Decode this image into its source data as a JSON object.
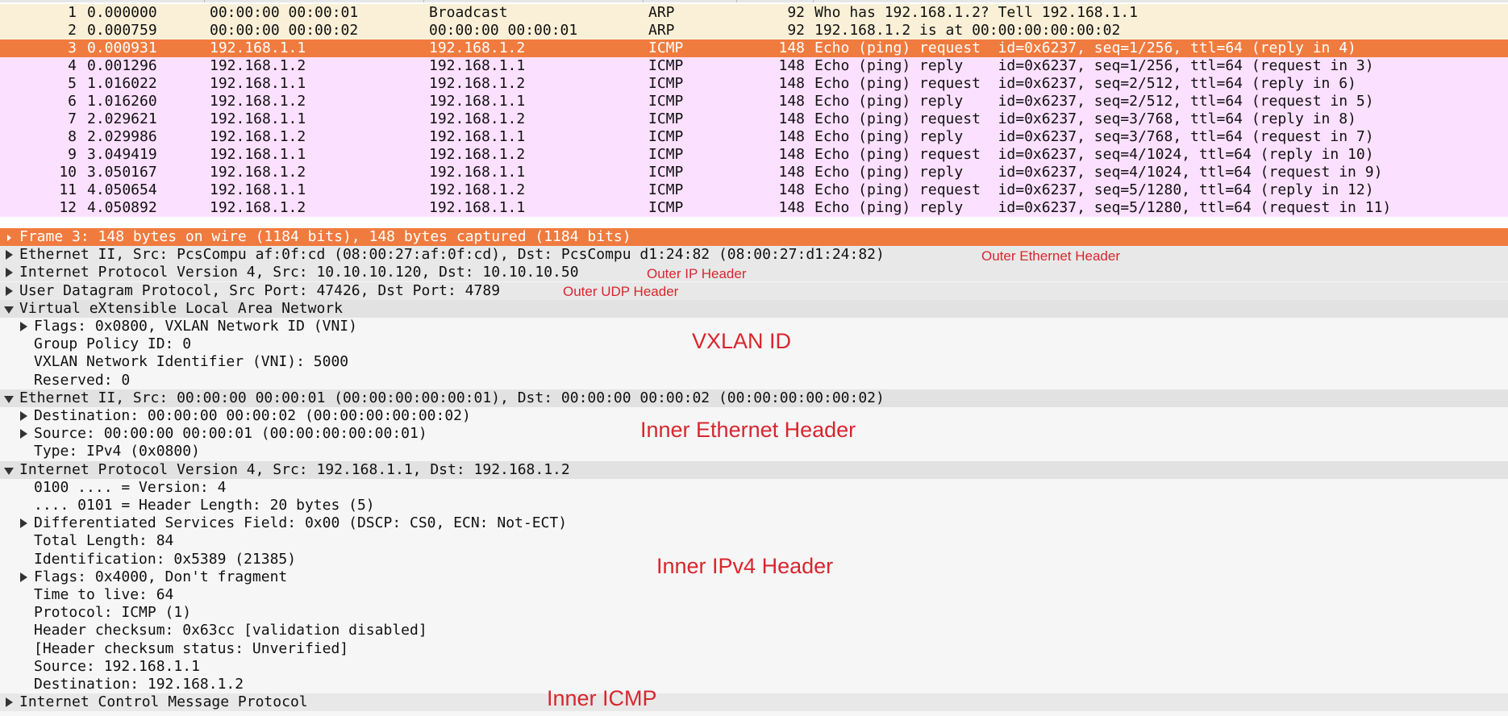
{
  "colors": {
    "arp_row_bg": "#faf0d7",
    "icmp_row_bg": "#fce0ff",
    "selected_row_bg": "#f07b3f",
    "selected_row_text": "#ffffff",
    "tree_header_bg": "#e2e2e2",
    "detail_bg": "#f6f6f6",
    "annotation": "#d8262e"
  },
  "packet_list": {
    "selected_no": "3",
    "rows": [
      {
        "no": "1",
        "time": "0.000000",
        "src": "00:00:00 00:00:01",
        "dst": "Broadcast",
        "proto": "ARP",
        "len": "92",
        "info": "Who has 192.168.1.2? Tell 192.168.1.1",
        "kind": "arp"
      },
      {
        "no": "2",
        "time": "0.000759",
        "src": "00:00:00 00:00:02",
        "dst": "00:00:00 00:00:01",
        "proto": "ARP",
        "len": "92",
        "info": "192.168.1.2 is at 00:00:00:00:00:02",
        "kind": "arp"
      },
      {
        "no": "3",
        "time": "0.000931",
        "src": "192.168.1.1",
        "dst": "192.168.1.2",
        "proto": "ICMP",
        "len": "148",
        "info": "Echo (ping) request  id=0x6237, seq=1/256, ttl=64 (reply in 4)",
        "kind": "selected"
      },
      {
        "no": "4",
        "time": "0.001296",
        "src": "192.168.1.2",
        "dst": "192.168.1.1",
        "proto": "ICMP",
        "len": "148",
        "info": "Echo (ping) reply    id=0x6237, seq=1/256, ttl=64 (request in 3)",
        "kind": "icmp"
      },
      {
        "no": "5",
        "time": "1.016022",
        "src": "192.168.1.1",
        "dst": "192.168.1.2",
        "proto": "ICMP",
        "len": "148",
        "info": "Echo (ping) request  id=0x6237, seq=2/512, ttl=64 (reply in 6)",
        "kind": "icmp"
      },
      {
        "no": "6",
        "time": "1.016260",
        "src": "192.168.1.2",
        "dst": "192.168.1.1",
        "proto": "ICMP",
        "len": "148",
        "info": "Echo (ping) reply    id=0x6237, seq=2/512, ttl=64 (request in 5)",
        "kind": "icmp"
      },
      {
        "no": "7",
        "time": "2.029621",
        "src": "192.168.1.1",
        "dst": "192.168.1.2",
        "proto": "ICMP",
        "len": "148",
        "info": "Echo (ping) request  id=0x6237, seq=3/768, ttl=64 (reply in 8)",
        "kind": "icmp"
      },
      {
        "no": "8",
        "time": "2.029986",
        "src": "192.168.1.2",
        "dst": "192.168.1.1",
        "proto": "ICMP",
        "len": "148",
        "info": "Echo (ping) reply    id=0x6237, seq=3/768, ttl=64 (request in 7)",
        "kind": "icmp"
      },
      {
        "no": "9",
        "time": "3.049419",
        "src": "192.168.1.1",
        "dst": "192.168.1.2",
        "proto": "ICMP",
        "len": "148",
        "info": "Echo (ping) request  id=0x6237, seq=4/1024, ttl=64 (reply in 10)",
        "kind": "icmp"
      },
      {
        "no": "10",
        "time": "3.050167",
        "src": "192.168.1.2",
        "dst": "192.168.1.1",
        "proto": "ICMP",
        "len": "148",
        "info": "Echo (ping) reply    id=0x6237, seq=4/1024, ttl=64 (request in 9)",
        "kind": "icmp"
      },
      {
        "no": "11",
        "time": "4.050654",
        "src": "192.168.1.1",
        "dst": "192.168.1.2",
        "proto": "ICMP",
        "len": "148",
        "info": "Echo (ping) request  id=0x6237, seq=5/1280, ttl=64 (reply in 12)",
        "kind": "icmp"
      },
      {
        "no": "12",
        "time": "4.050892",
        "src": "192.168.1.2",
        "dst": "192.168.1.1",
        "proto": "ICMP",
        "len": "148",
        "info": "Echo (ping) reply    id=0x6237, seq=5/1280, ttl=64 (request in 11)",
        "kind": "icmp"
      }
    ]
  },
  "details": {
    "rows": [
      {
        "text": "Frame 3: 148 bytes on wire (1184 bits), 148 bytes captured (1184 bits)",
        "level": 0,
        "state": "collapsed",
        "style": "selected"
      },
      {
        "text": "Ethernet II, Src: PcsCompu af:0f:cd (08:00:27:af:0f:cd), Dst: PcsCompu d1:24:82 (08:00:27:d1:24:82)",
        "level": 0,
        "state": "collapsed",
        "style": "header"
      },
      {
        "text": "Internet Protocol Version 4, Src: 10.10.10.120, Dst: 10.10.10.50",
        "level": 0,
        "state": "collapsed",
        "style": "header"
      },
      {
        "text": "User Datagram Protocol, Src Port: 47426, Dst Port: 4789",
        "level": 0,
        "state": "collapsed",
        "style": "header"
      },
      {
        "text": "Virtual eXtensible Local Area Network",
        "level": 0,
        "state": "expanded",
        "style": "header"
      },
      {
        "text": "Flags: 0x0800, VXLAN Network ID (VNI)",
        "level": 1,
        "state": "collapsed",
        "style": "field"
      },
      {
        "text": "Group Policy ID: 0",
        "level": 1,
        "state": "leaf",
        "style": "field"
      },
      {
        "text": "VXLAN Network Identifier (VNI): 5000",
        "level": 1,
        "state": "leaf",
        "style": "field"
      },
      {
        "text": "Reserved: 0",
        "level": 1,
        "state": "leaf",
        "style": "field"
      },
      {
        "text": "Ethernet II, Src: 00:00:00 00:00:01 (00:00:00:00:00:01), Dst: 00:00:00 00:00:02 (00:00:00:00:00:02)",
        "level": 0,
        "state": "expanded",
        "style": "header"
      },
      {
        "text": "Destination: 00:00:00 00:00:02 (00:00:00:00:00:02)",
        "level": 1,
        "state": "collapsed",
        "style": "field"
      },
      {
        "text": "Source: 00:00:00 00:00:01 (00:00:00:00:00:01)",
        "level": 1,
        "state": "collapsed",
        "style": "field"
      },
      {
        "text": "Type: IPv4 (0x0800)",
        "level": 1,
        "state": "leaf",
        "style": "field"
      },
      {
        "text": "Internet Protocol Version 4, Src: 192.168.1.1, Dst: 192.168.1.2",
        "level": 0,
        "state": "expanded",
        "style": "header"
      },
      {
        "text": "0100 .... = Version: 4",
        "level": 1,
        "state": "leaf",
        "style": "field"
      },
      {
        "text": ".... 0101 = Header Length: 20 bytes (5)",
        "level": 1,
        "state": "leaf",
        "style": "field"
      },
      {
        "text": "Differentiated Services Field: 0x00 (DSCP: CS0, ECN: Not-ECT)",
        "level": 1,
        "state": "collapsed",
        "style": "field"
      },
      {
        "text": "Total Length: 84",
        "level": 1,
        "state": "leaf",
        "style": "field"
      },
      {
        "text": "Identification: 0x5389 (21385)",
        "level": 1,
        "state": "leaf",
        "style": "field"
      },
      {
        "text": "Flags: 0x4000, Don't fragment",
        "level": 1,
        "state": "collapsed",
        "style": "field"
      },
      {
        "text": "Time to live: 64",
        "level": 1,
        "state": "leaf",
        "style": "field"
      },
      {
        "text": "Protocol: ICMP (1)",
        "level": 1,
        "state": "leaf",
        "style": "field"
      },
      {
        "text": "Header checksum: 0x63cc [validation disabled]",
        "level": 1,
        "state": "leaf",
        "style": "field"
      },
      {
        "text": "[Header checksum status: Unverified]",
        "level": 1,
        "state": "leaf",
        "style": "field"
      },
      {
        "text": "Source: 192.168.1.1",
        "level": 1,
        "state": "leaf",
        "style": "field"
      },
      {
        "text": "Destination: 192.168.1.2",
        "level": 1,
        "state": "leaf",
        "style": "field"
      },
      {
        "text": "Internet Control Message Protocol",
        "level": 0,
        "state": "collapsed",
        "style": "header"
      }
    ]
  },
  "annotations": [
    {
      "text": "Outer Ethernet Header",
      "size": "small"
    },
    {
      "text": "Outer IP Header",
      "size": "small"
    },
    {
      "text": "Outer UDP Header",
      "size": "small"
    },
    {
      "text": "VXLAN ID",
      "size": "large"
    },
    {
      "text": "Inner Ethernet Header",
      "size": "large"
    },
    {
      "text": "Inner IPv4 Header",
      "size": "large"
    },
    {
      "text": "Inner ICMP",
      "size": "large"
    }
  ]
}
